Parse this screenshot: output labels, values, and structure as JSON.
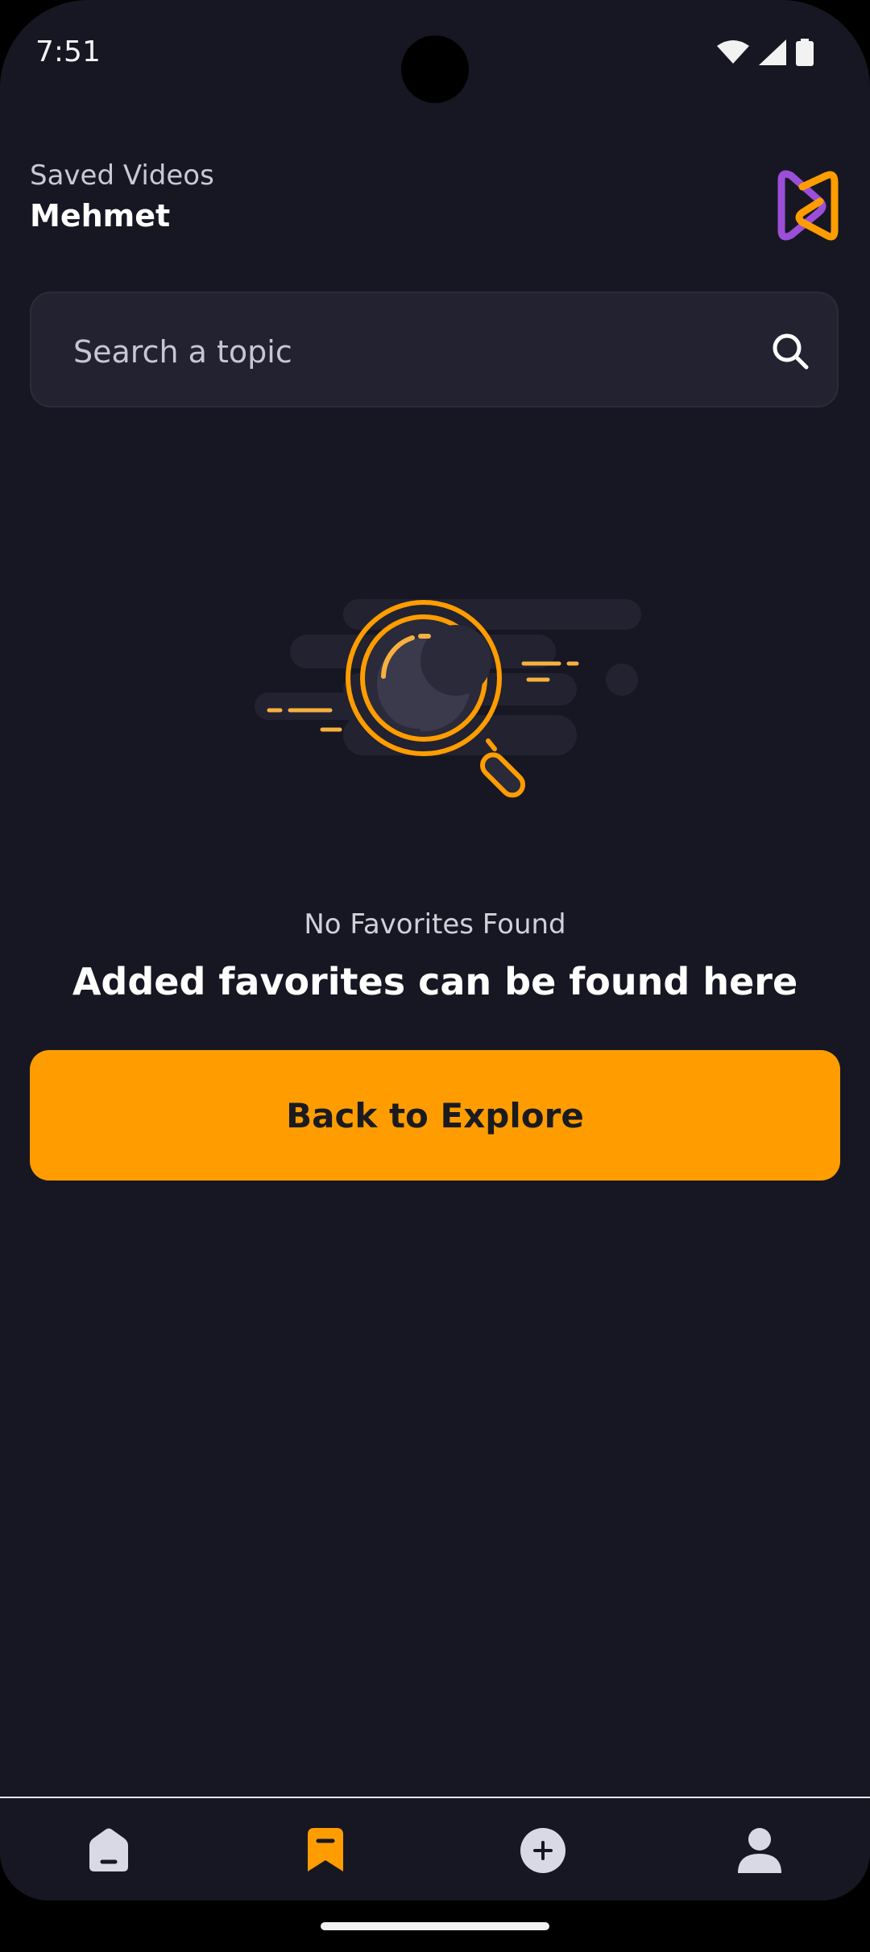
{
  "status_bar": {
    "time": "7:51"
  },
  "header": {
    "subtitle": "Saved Videos",
    "title": "Mehmet"
  },
  "search": {
    "placeholder": "Search a topic",
    "value": ""
  },
  "empty_state": {
    "subtitle": "No Favorites Found",
    "title": "Added favorites can be found here",
    "button_label": "Back to Explore"
  },
  "bottom_nav": {
    "items": [
      {
        "icon": "home-icon",
        "active": false
      },
      {
        "icon": "bookmark-icon",
        "active": true
      },
      {
        "icon": "add-icon",
        "active": false
      },
      {
        "icon": "profile-icon",
        "active": false
      }
    ]
  },
  "colors": {
    "background": "#171723",
    "accent": "#ff9d00",
    "logo_purple": "#9b4fd8",
    "inactive_icon": "#d9d9e6"
  }
}
